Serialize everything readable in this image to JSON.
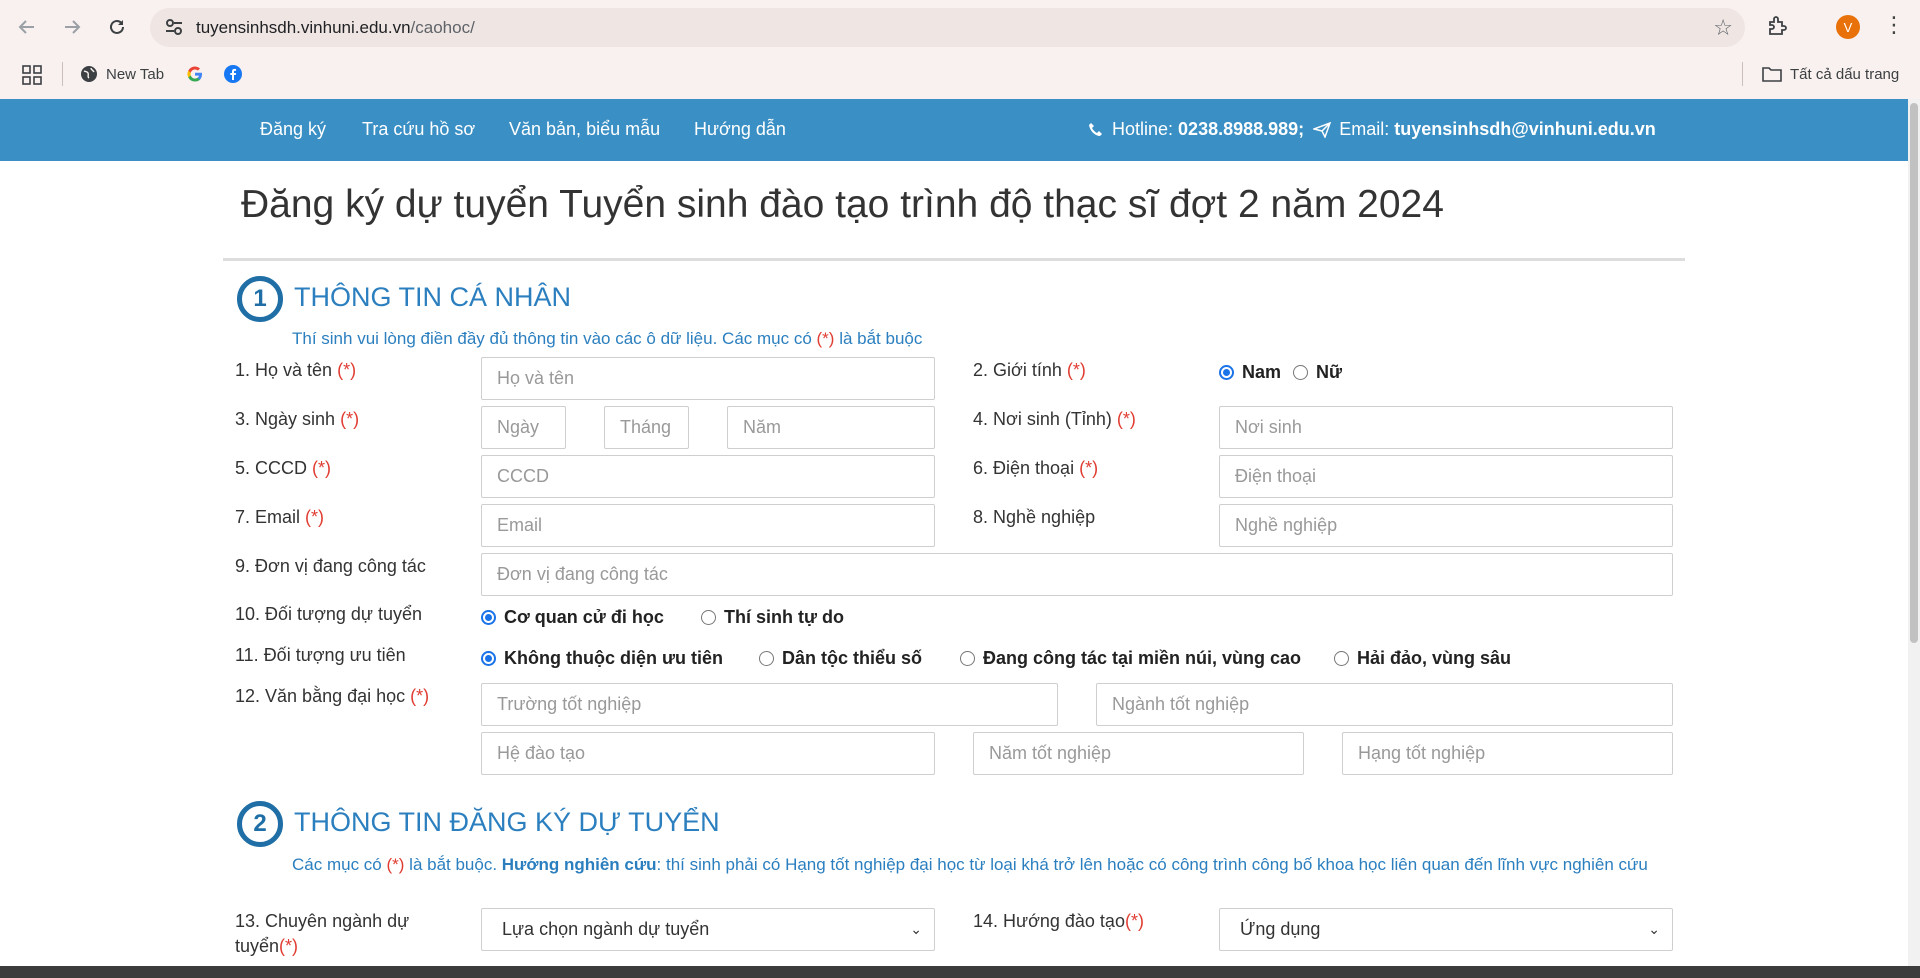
{
  "browser": {
    "url_host": "tuyensinhsdh.vinhuni.edu.vn",
    "url_path": "/caohoc/",
    "avatar_letter": "V",
    "bookmarks": [
      {
        "label": "New Tab",
        "icon": "globe-icon"
      },
      {
        "label": "",
        "icon": "google-icon"
      },
      {
        "label": "",
        "icon": "facebook-icon"
      }
    ],
    "all_bookmarks_label": "Tất cả dấu trang"
  },
  "header": {
    "menu": [
      "Đăng ký",
      "Tra cứu hồ sơ",
      "Văn bản, biểu mẫu",
      "Hướng dẫn"
    ],
    "hotline_label": "Hotline:",
    "hotline_value": "0238.8988.989;",
    "email_label": "Email:",
    "email_value": "tuyensinhsdh@vinhuni.edu.vn",
    "color": "#3a8fc4"
  },
  "page_title": "Đăng ký dự tuyển Tuyển sinh đào tạo trình độ thạc sĩ đợt 2 năm 2024",
  "section1": {
    "number": "1",
    "title": "THÔNG TIN CÁ NHÂN",
    "note_before": "Thí sinh vui lòng điền đầy đủ thông tin vào các ô dữ liệu. Các mục có ",
    "note_req": "(*)",
    "note_after": " là bắt buộc",
    "fields": {
      "name": {
        "label": "1. Họ và tên",
        "req": "(*)",
        "placeholder": "Họ và tên"
      },
      "gender": {
        "label": "2. Giới tính",
        "req": "(*)",
        "options": [
          "Nam",
          "Nữ"
        ],
        "selected": "Nam"
      },
      "dob": {
        "label": "3. Ngày sinh",
        "req": "(*)",
        "ph_day": "Ngày",
        "ph_month": "Tháng",
        "ph_year": "Năm"
      },
      "birthplace": {
        "label": "4. Nơi sinh (Tỉnh)",
        "req": "(*)",
        "placeholder": "Nơi sinh"
      },
      "cccd": {
        "label": "5. CCCD",
        "req": "(*)",
        "placeholder": "CCCD"
      },
      "phone": {
        "label": "6. Điện thoại",
        "req": "(*)",
        "placeholder": "Điện thoại"
      },
      "email": {
        "label": "7. Email",
        "req": "(*)",
        "placeholder": "Email"
      },
      "job": {
        "label": "8. Nghề nghiệp",
        "placeholder": "Nghề nghiệp"
      },
      "workplace": {
        "label": "9. Đơn vị đang công tác",
        "placeholder": "Đơn vị đang công tác"
      },
      "candidate_type": {
        "label": "10. Đối tượng dự tuyển",
        "options": [
          "Cơ quan cử đi học",
          "Thí sinh tự do"
        ],
        "selected": "Cơ quan cử đi học"
      },
      "priority": {
        "label": "11. Đối tượng ưu tiên",
        "options": [
          "Không thuộc diện ưu tiên",
          "Dân tộc thiểu số",
          "Đang công tác tại miền núi, vùng cao",
          "Hải đảo, vùng sâu"
        ],
        "selected": "Không thuộc diện ưu tiên"
      },
      "degree": {
        "label": "12. Văn bằng đại học",
        "req": "(*)",
        "ph_school": "Trường tốt nghiệp",
        "ph_major": "Ngành tốt nghiệp",
        "ph_system": "Hệ đào tạo",
        "ph_year": "Năm tốt nghiệp",
        "ph_rank": "Hạng tốt nghiệp"
      }
    }
  },
  "section2": {
    "number": "2",
    "title": "THÔNG TIN ĐĂNG KÝ DỰ TUYỂN",
    "note_a": "Các mục có ",
    "note_req": "(*)",
    "note_b": " là bắt buộc. ",
    "note_bold": "Hướng nghiên cứu",
    "note_c": ": thí sinh phải có Hạng tốt nghiệp đại học từ loại khá trở lên hoặc có công trình công bố khoa học liên quan đến lĩnh vực nghiên cứu",
    "major": {
      "label": "13. Chuyên ngành dự tuyển",
      "req": "(*)",
      "value": "Lựa chọn ngành dự tuyển"
    },
    "direction": {
      "label": "14. Hướng đào tạo",
      "req": "(*)",
      "value": "Ứng dụng"
    }
  }
}
